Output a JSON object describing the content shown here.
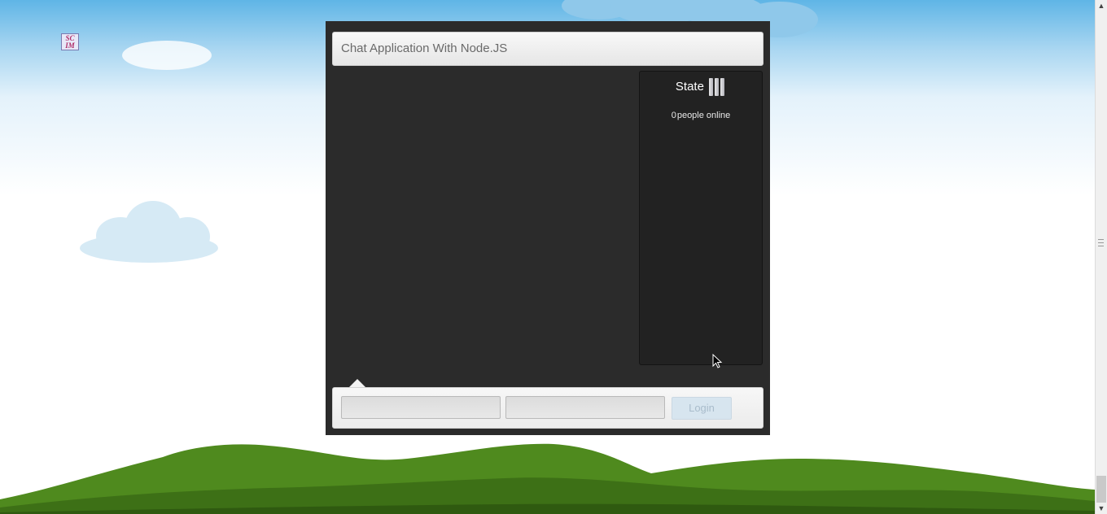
{
  "app": {
    "title": "Chat Application With Node.JS"
  },
  "sidebar": {
    "state_label": "State",
    "online_count": "0",
    "online_text": "people online"
  },
  "login": {
    "username_value": "",
    "password_value": "",
    "button_label": "Login"
  },
  "logo": {
    "text_line1": "SC",
    "text_line2": "IM"
  },
  "colors": {
    "panel_bg": "#2b2b2b",
    "sidebar_bg": "#222222",
    "login_button_bg": "#d7e5ef"
  }
}
